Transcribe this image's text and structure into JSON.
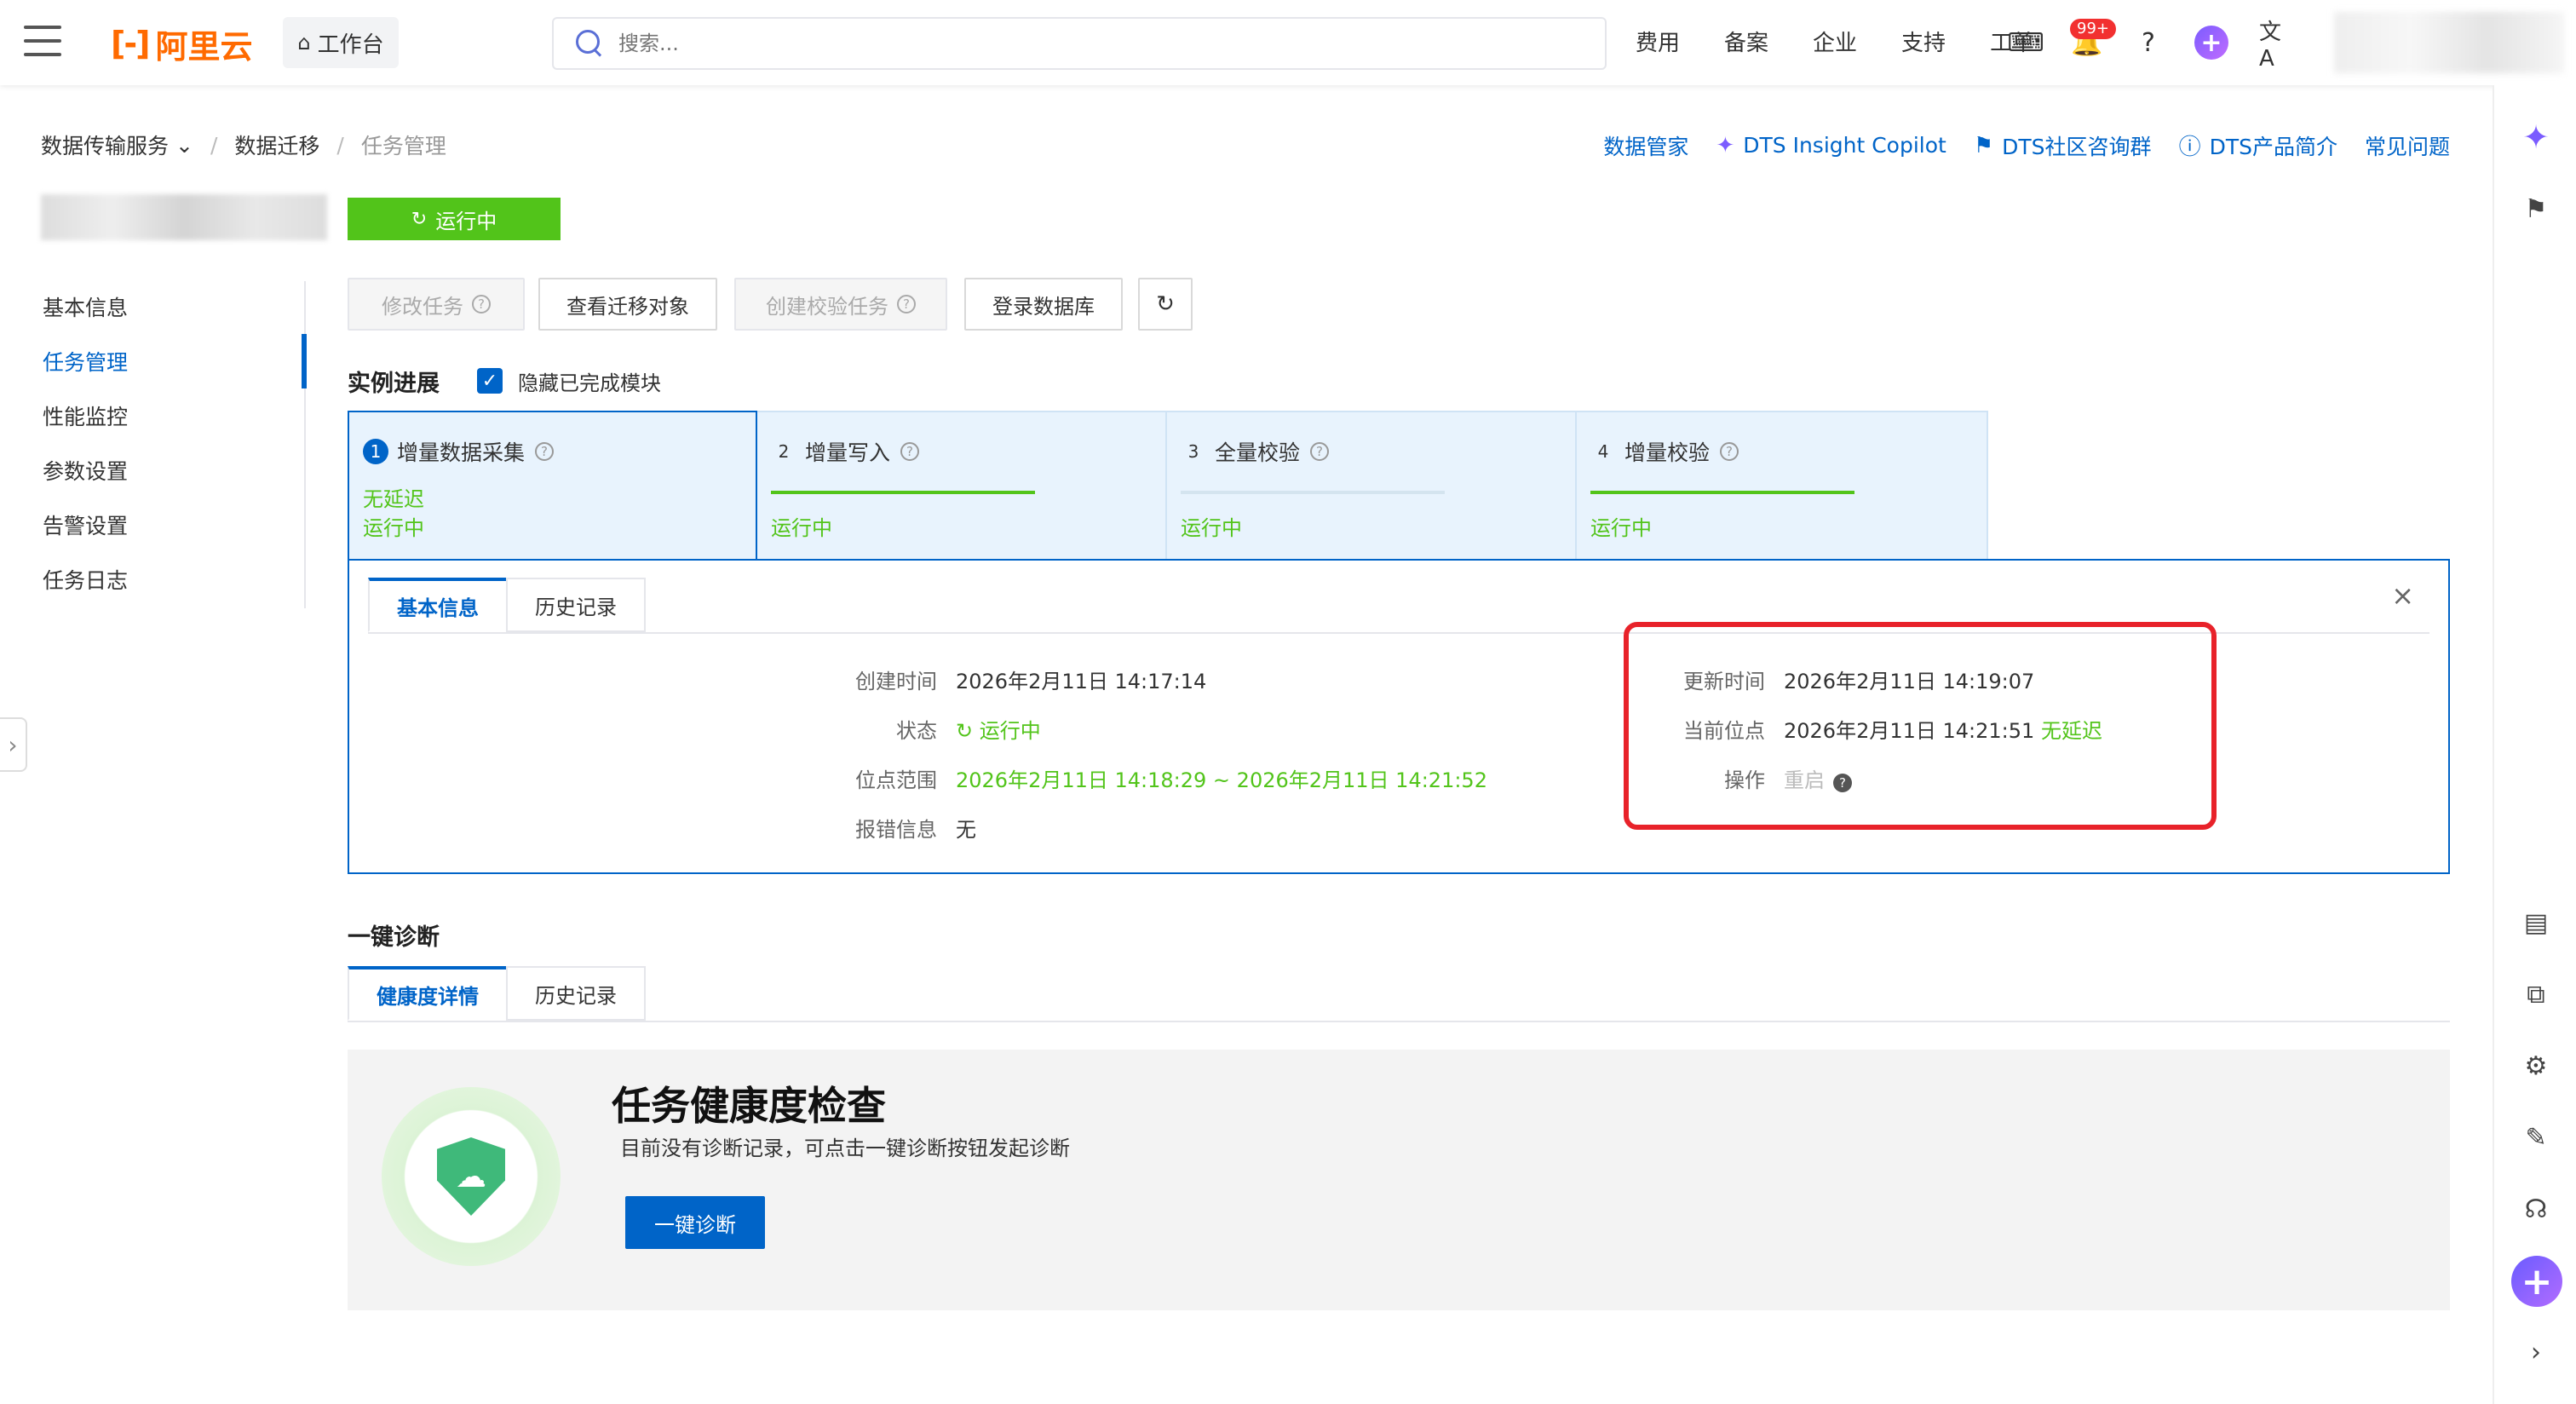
{
  "topbar": {
    "logo_text": "阿里云",
    "workbench": "工作台",
    "search_placeholder": "搜索...",
    "nav": [
      "费用",
      "备案",
      "企业",
      "支持",
      "工单"
    ],
    "badge": "99+"
  },
  "breadcrumb": {
    "service": "数据传输服务",
    "migration": "数据迁移",
    "current": "任务管理"
  },
  "toplinks": [
    "数据管家",
    "DTS Insight Copilot",
    "DTS社区咨询群",
    "DTS产品简介",
    "常见问题"
  ],
  "status_pill": "运行中",
  "leftnav": [
    "基本信息",
    "任务管理",
    "性能监控",
    "参数设置",
    "告警设置",
    "任务日志"
  ],
  "actions": {
    "modify": "修改任务",
    "view_objects": "查看迁移对象",
    "create_check": "创建校验任务",
    "login_db": "登录数据库"
  },
  "progress": {
    "title": "实例进展",
    "hide_completed": "隐藏已完成模块",
    "steps": [
      {
        "num": "1",
        "name": "增量数据采集",
        "sub": "无延迟",
        "status": "运行中",
        "progress": 0
      },
      {
        "num": "2",
        "name": "增量写入",
        "sub": "",
        "status": "运行中",
        "progress": 1.0
      },
      {
        "num": "3",
        "name": "全量校验",
        "sub": "",
        "status": "运行中",
        "progress": 0
      },
      {
        "num": "4",
        "name": "增量校验",
        "sub": "",
        "status": "运行中",
        "progress": 1.0
      }
    ]
  },
  "detail": {
    "tab_basic": "基本信息",
    "tab_history": "历史记录",
    "create_time_label": "创建时间",
    "create_time": "2026年2月11日 14:17:14",
    "status_label": "状态",
    "status": "运行中",
    "range_label": "位点范围",
    "range": "2026年2月11日 14:18:29 ~ 2026年2月11日 14:21:52",
    "error_label": "报错信息",
    "error": "无",
    "update_time_label": "更新时间",
    "update_time": "2026年2月11日 14:19:07",
    "current_pos_label": "当前位点",
    "current_pos": "2026年2月11日 14:21:51",
    "current_pos_delay": "无延迟",
    "op_label": "操作",
    "op": "重启"
  },
  "diagnosis": {
    "title": "一键诊断",
    "tab_health": "健康度详情",
    "tab_history": "历史记录",
    "health_title": "任务健康度检查",
    "health_desc": "目前没有诊断记录，可点击一键诊断按钮发起诊断",
    "button": "一键诊断"
  },
  "colors": {
    "accent": "#0064c8",
    "running": "#52c41a",
    "brand": "#ff6a00",
    "highlight": "#e8222a"
  }
}
